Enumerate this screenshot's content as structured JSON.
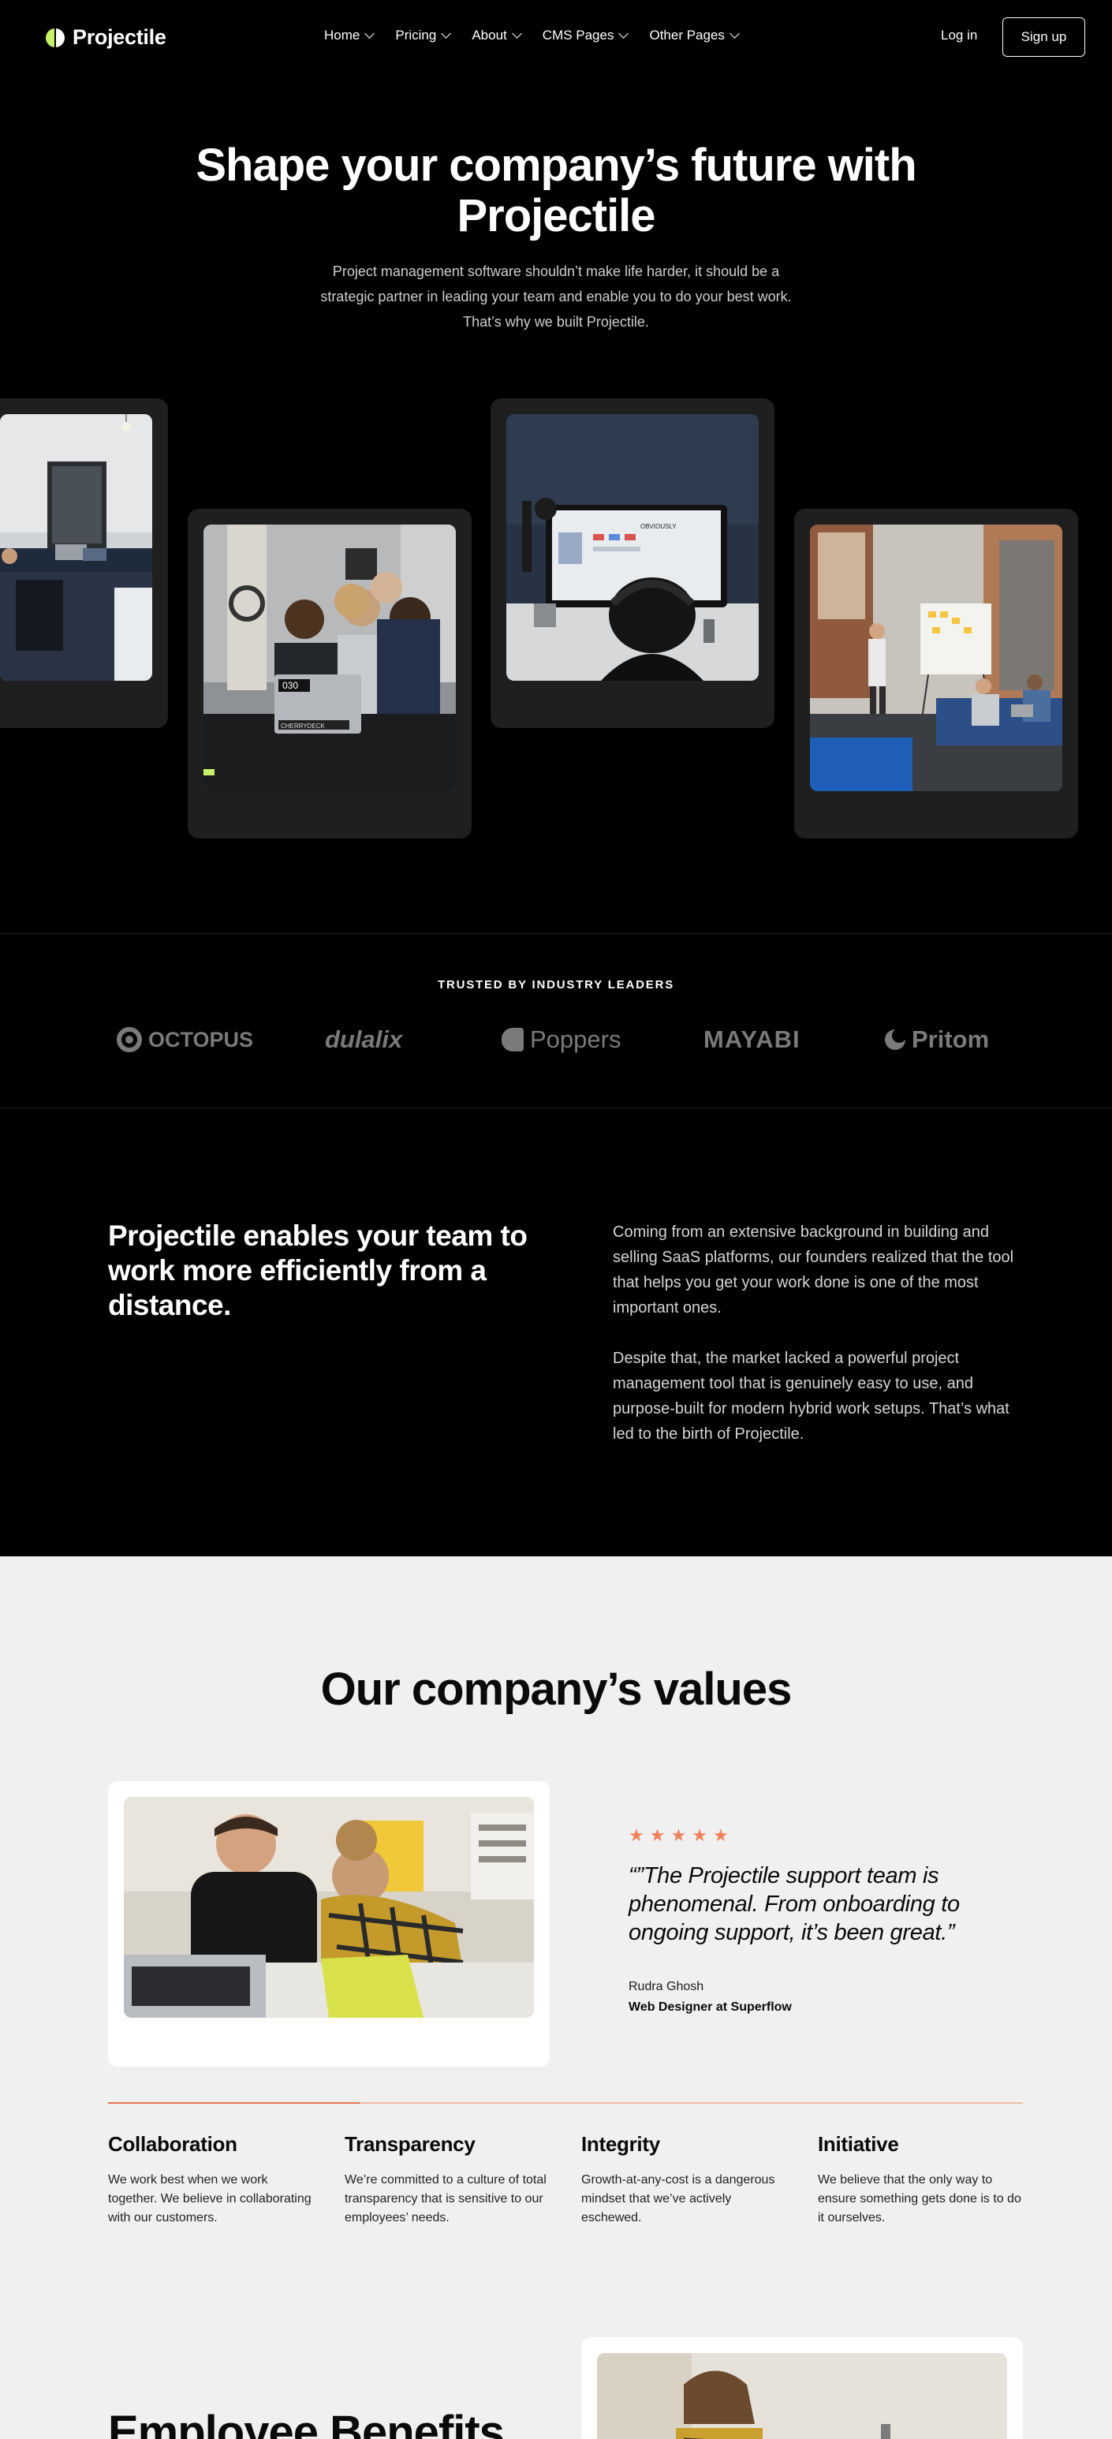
{
  "nav": {
    "logo_text": "Projectile",
    "menu": [
      {
        "label": "Home"
      },
      {
        "label": "Pricing"
      },
      {
        "label": "About"
      },
      {
        "label": "CMS Pages"
      },
      {
        "label": "Other Pages"
      }
    ],
    "login_label": "Log in",
    "signup_label": "Sign up"
  },
  "hero": {
    "title": "Shape your company’s future with Projectile",
    "subtitle": "Project management software shouldn’t make life harder, it should be a strategic partner in leading your team and enable you to do your best work. That’s why we built Projectile."
  },
  "trusted": {
    "title": "TRUSTED BY INDUSTRY LEADERS",
    "brands": [
      "OCTOPUS",
      "dulalix",
      "Poppers",
      "MAYABI",
      "Pritom"
    ]
  },
  "mission": {
    "title": "Projectile enables your team to work more efficiently from a distance.",
    "paragraph1": "Coming from an extensive background in building and selling SaaS platforms, our founders realized that the tool that helps you get your work done is one of the most important ones.",
    "paragraph2": "Despite that, the market lacked a powerful project management tool that is genuinely easy to use, and purpose-built for modern hybrid work setups. That’s what led to the birth of Projectile."
  },
  "values": {
    "title": "Our company’s values",
    "rating": 5,
    "quote": "“”The Projectile support team is phenomenal. From onboarding to ongoing support, it’s been great.”",
    "author_name": "Rudra Ghosh",
    "author_role": "Web Designer at Superflow",
    "progress_fraction": 0.275,
    "items": [
      {
        "title": "Collaboration",
        "text": "We work best when we work together. We believe in collaborating with our customers."
      },
      {
        "title": "Transparency",
        "text": "We’re committed to a culture of total transparency that is sensitive to our employees’ needs."
      },
      {
        "title": "Integrity",
        "text": "Growth-at-any-cost is a dangerous mindset that we’ve actively eschewed."
      },
      {
        "title": "Initiative",
        "text": "We believe that the only way to ensure something gets done is to do it ourselves."
      }
    ]
  },
  "benefits": {
    "title": "Employee Benefits"
  },
  "colors": {
    "accent_green": "#c7f26a",
    "star_orange": "#f0805a",
    "progress_orange": "#e5734e"
  }
}
